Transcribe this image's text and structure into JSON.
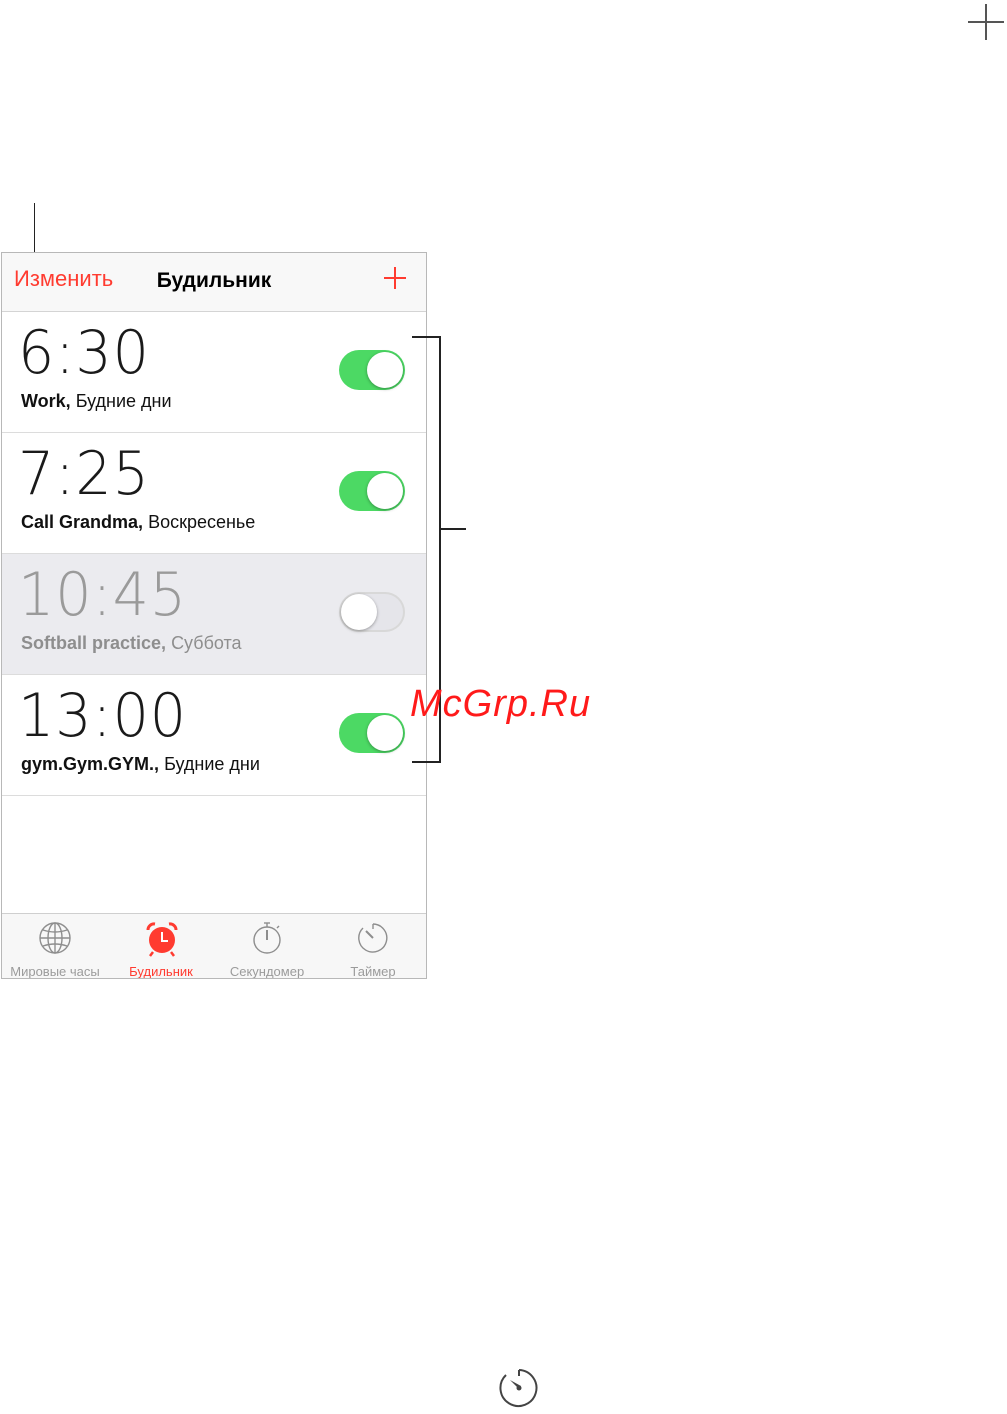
{
  "navbar": {
    "edit_label": "Изменить",
    "title": "Будильник"
  },
  "alarms": [
    {
      "time": "6:30",
      "name": "Work,",
      "repeat": "Будние дни",
      "enabled": true
    },
    {
      "time": "7:25",
      "name": "Call Grandma,",
      "repeat": "Воскресенье",
      "enabled": true
    },
    {
      "time": "10:45",
      "name": "Softball practice,",
      "repeat": "Суббота",
      "enabled": false
    },
    {
      "time": "13:00",
      "name": "gym.Gym.GYM.,",
      "repeat": "Будние дни",
      "enabled": true
    }
  ],
  "tabs": [
    {
      "label": "Мировые часы",
      "icon": "globe-icon",
      "active": false
    },
    {
      "label": "Будильник",
      "icon": "alarm-clock-icon",
      "active": true
    },
    {
      "label": "Секундомер",
      "icon": "stopwatch-icon",
      "active": false
    },
    {
      "label": "Таймер",
      "icon": "timer-icon",
      "active": false
    }
  ],
  "watermark": "McGrp.Ru",
  "colors": {
    "accent": "#ff3b30",
    "toggle_on": "#4cd964",
    "disabled_row": "#ebebef"
  }
}
